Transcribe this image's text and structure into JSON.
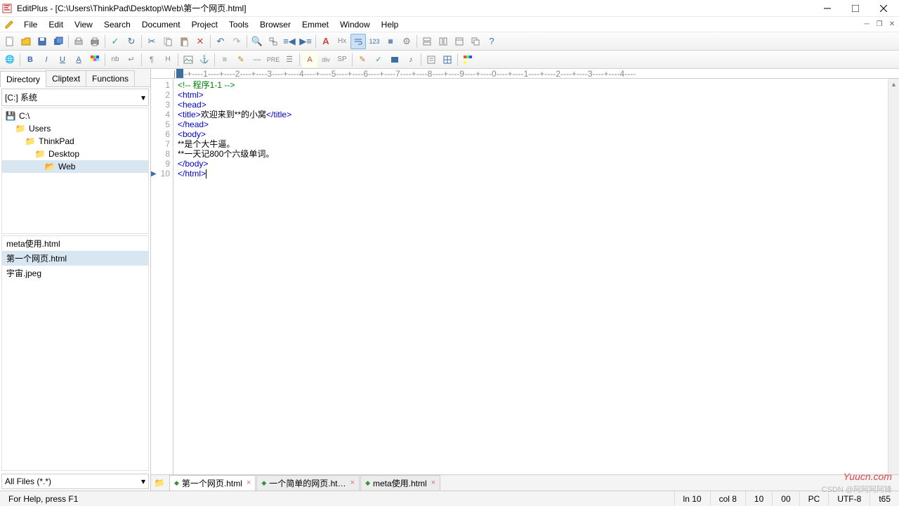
{
  "title": "EditPlus - [C:\\Users\\ThinkPad\\Desktop\\Web\\第一个网页.html]",
  "menu": [
    "File",
    "Edit",
    "View",
    "Search",
    "Document",
    "Project",
    "Tools",
    "Browser",
    "Emmet",
    "Window",
    "Help"
  ],
  "side_tabs": {
    "directory": "Directory",
    "cliptext": "Cliptext",
    "functions": "Functions"
  },
  "drive": "[C:] 系统",
  "tree": [
    {
      "label": "C:\\",
      "indent": 0
    },
    {
      "label": "Users",
      "indent": 1
    },
    {
      "label": "ThinkPad",
      "indent": 2
    },
    {
      "label": "Desktop",
      "indent": 3
    },
    {
      "label": "Web",
      "indent": 4
    }
  ],
  "files": [
    "meta使用.html",
    "第一个网页.html",
    "宇宙.jpeg"
  ],
  "files_selected_index": 1,
  "filter": "All Files (*.*)",
  "ruler_text": "|----+----1----+----2----+----3----+----4----+----5----+----6----+----7----+----8----+----9----+----0----+----1----+----2----+----3----+----4----",
  "code": {
    "lines": [
      {
        "n": 1,
        "seg": [
          {
            "c": "comment",
            "t": "<!-- 程序1-1 -->"
          }
        ]
      },
      {
        "n": 2,
        "seg": [
          {
            "c": "tag",
            "t": "<html>"
          }
        ]
      },
      {
        "n": 3,
        "seg": [
          {
            "c": "tag",
            "t": "<head>"
          }
        ]
      },
      {
        "n": 4,
        "seg": [
          {
            "c": "tag",
            "t": "<title>"
          },
          {
            "c": "text",
            "t": "欢迎来到**的小窝"
          },
          {
            "c": "tag",
            "t": "</title>"
          }
        ]
      },
      {
        "n": 5,
        "seg": [
          {
            "c": "tag",
            "t": "</head>"
          }
        ]
      },
      {
        "n": 6,
        "seg": [
          {
            "c": "tag",
            "t": "<body>"
          }
        ]
      },
      {
        "n": 7,
        "seg": [
          {
            "c": "text",
            "t": "**是个大牛逼。"
          }
        ]
      },
      {
        "n": 8,
        "seg": [
          {
            "c": "text",
            "t": "**一天记800个六级单词。"
          }
        ]
      },
      {
        "n": 9,
        "seg": [
          {
            "c": "tag",
            "t": "</body>"
          }
        ]
      },
      {
        "n": 10,
        "seg": [
          {
            "c": "tag",
            "t": "</html>"
          }
        ],
        "caret": true
      }
    ],
    "current_line": 10
  },
  "doc_tabs": [
    {
      "label": "第一个网页.html",
      "active": true,
      "dirty": true
    },
    {
      "label": "一个简单的网页.ht…",
      "active": false,
      "dirty": true
    },
    {
      "label": "meta使用.html",
      "active": false,
      "dirty": true
    }
  ],
  "status": {
    "help": "For Help, press F1",
    "ln": "ln 10",
    "col": "col 8",
    "v1": "10",
    "v2": "00",
    "enc1": "PC",
    "enc2": "UTF-8",
    "end": "t65"
  },
  "watermark1": "Yuucn.com",
  "watermark2": "CSDN @阿阿阿阿锋",
  "colors": {
    "tag": "#0000cd",
    "comment": "#008000",
    "selection": "#d8e6f2"
  }
}
